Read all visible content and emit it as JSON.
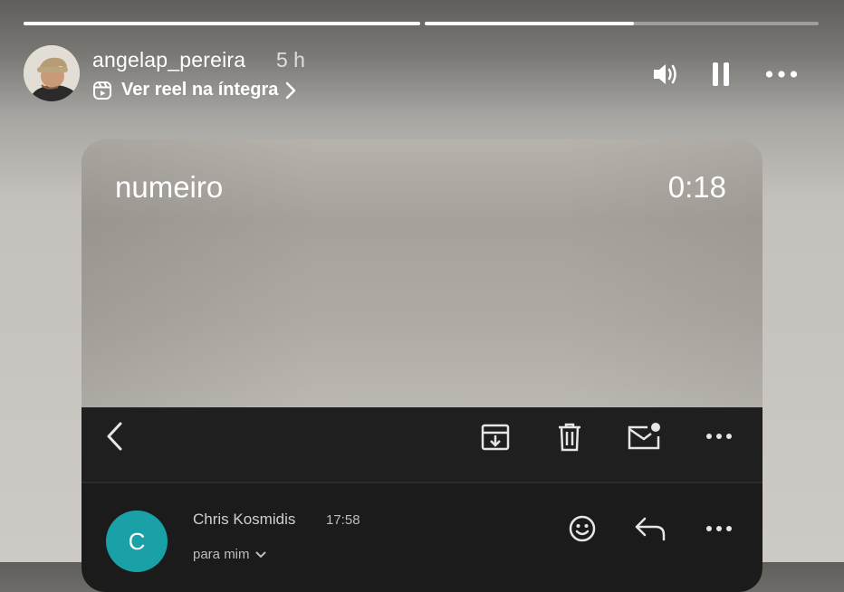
{
  "story": {
    "progress": [
      {
        "fill_percent": 100
      },
      {
        "fill_percent": 53
      }
    ],
    "username": "angelap_pereira",
    "time_ago": "5 h",
    "reel_link": "Ver reel na íntegra",
    "icons": {
      "volume": "volume-icon",
      "pause": "pause-icon",
      "more": "more-icon"
    }
  },
  "video": {
    "title": "numeiro",
    "timer": "0:18"
  },
  "email": {
    "toolbar_icons": [
      "back-icon",
      "archive-icon",
      "trash-icon",
      "mark-unread-icon",
      "more-icon"
    ],
    "sender_initial": "C",
    "sender_name": "Chris Kosmidis",
    "sent_time": "17:58",
    "recipient": "para mim",
    "action_icons": [
      "emoji-icon",
      "reply-icon",
      "more-icon"
    ],
    "colors": {
      "avatar": "#1aa1a8",
      "toolbar_bg": "#1f1f1f"
    }
  }
}
